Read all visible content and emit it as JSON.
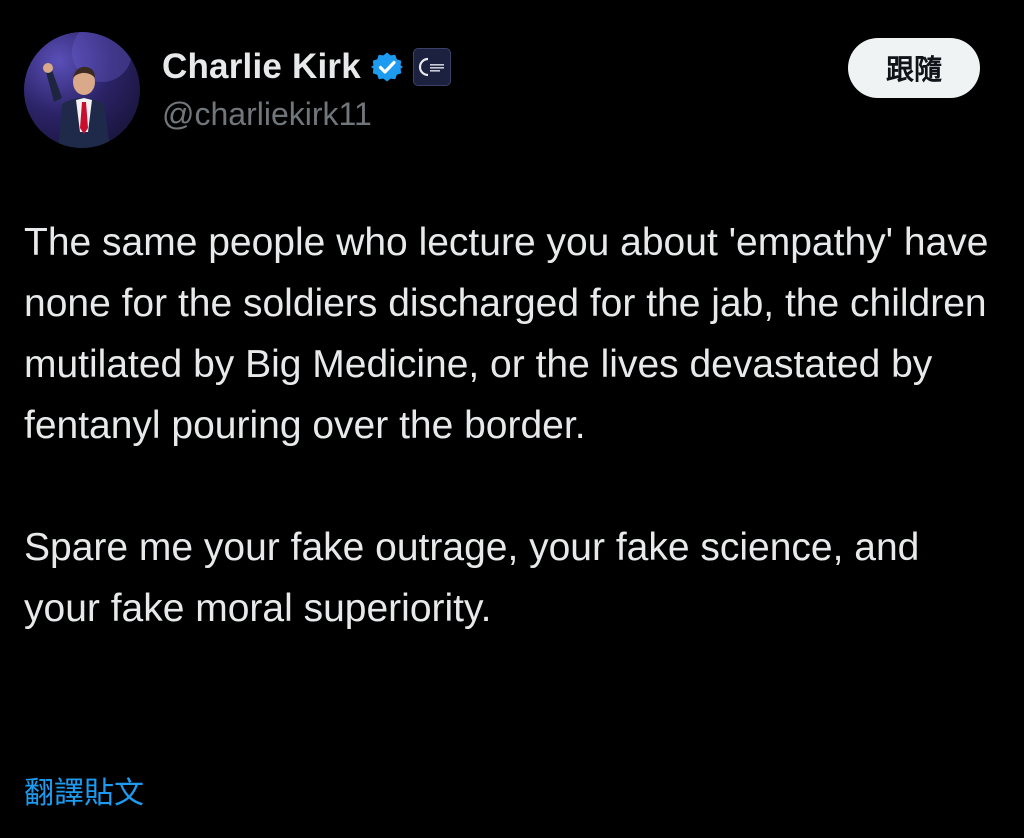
{
  "post": {
    "author": {
      "display_name": "Charlie Kirk",
      "handle": "@charliekirk11",
      "verified_icon": "verified-badge-icon",
      "affiliate_icon": "organization-affiliate-icon"
    },
    "follow_label": "跟隨",
    "paragraphs": [
      "The same people who lecture you about 'empathy' have none for the soldiers discharged for the jab, the children mutilated by Big Medicine, or the lives devastated by fentanyl pouring over the border.",
      "Spare me your fake outrage, your fake science, and your fake moral superiority."
    ],
    "translate_label": "翻譯貼文"
  },
  "colors": {
    "background": "#000000",
    "text_primary": "#e7e9ea",
    "text_secondary": "#71767b",
    "link": "#1d9bf0",
    "verified": "#1d9bf0",
    "button_bg": "#eff3f4"
  }
}
